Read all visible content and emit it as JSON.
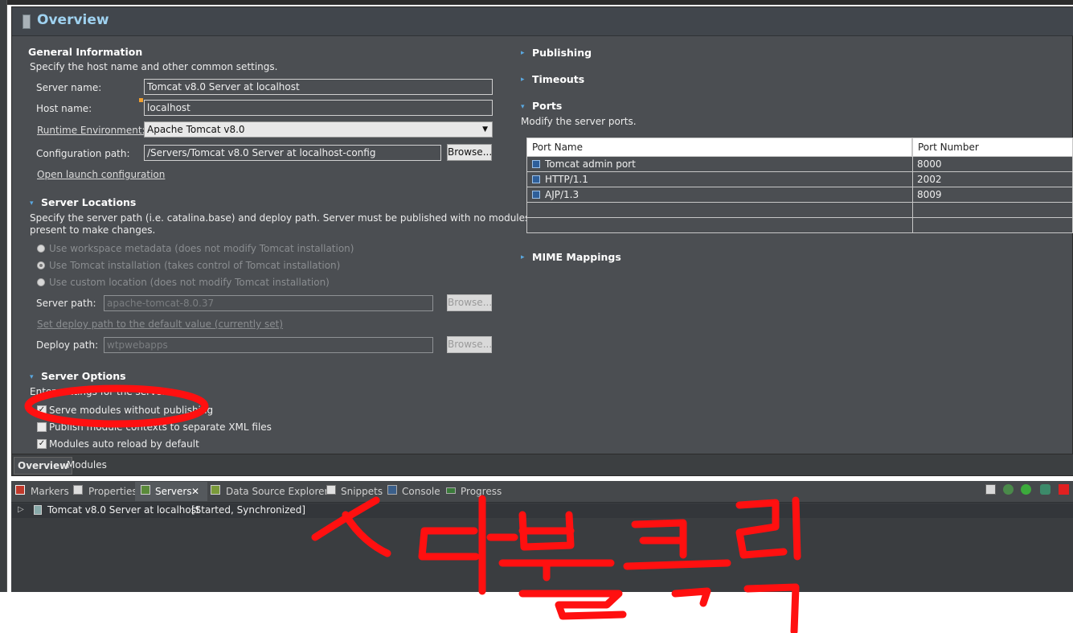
{
  "editor": {
    "title": "Overview",
    "general": {
      "title": "General Information",
      "desc": "Specify the host name and other common settings.",
      "server_name_label": "Server name:",
      "server_name_value": "Tomcat v8.0 Server at localhost",
      "host_name_label": "Host name:",
      "host_name_value": "localhost",
      "runtime_label": "Runtime Environment:",
      "runtime_value": "Apache Tomcat v8.0",
      "config_label": "Configuration path:",
      "config_value": "/Servers/Tomcat v8.0 Server at localhost-config",
      "browse_label": "Browse...",
      "open_launch_link": "Open launch configuration"
    },
    "locations": {
      "title": "Server Locations",
      "desc_line1": "Specify the server path (i.e. catalina.base) and deploy path. Server must be published with no modules",
      "desc_line2": "present to make changes.",
      "radio1": "Use workspace metadata (does not modify Tomcat installation)",
      "radio2": "Use Tomcat installation (takes control of Tomcat installation)",
      "radio3": "Use custom location (does not modify Tomcat installation)",
      "server_path_label": "Server path:",
      "server_path_value": "apache-tomcat-8.0.37",
      "browse_label": "Browse...",
      "set_deploy_link": "Set deploy path to the default value (currently set)",
      "deploy_path_label": "Deploy path:",
      "deploy_path_value": "wtpwebapps"
    },
    "options": {
      "title": "Server Options",
      "desc": "Enter settings for the server.",
      "opt1": "Serve modules without publishing",
      "opt2": "Publish module contexts to separate XML files",
      "opt3": "Modules auto reload by default"
    },
    "right": {
      "publishing": "Publishing",
      "timeouts": "Timeouts",
      "ports_title": "Ports",
      "ports_desc": "Modify the server ports.",
      "col_name": "Port Name",
      "col_number": "Port Number",
      "ports": [
        {
          "name": "Tomcat admin port",
          "number": "8000"
        },
        {
          "name": "HTTP/1.1",
          "number": "2002"
        },
        {
          "name": "AJP/1.3",
          "number": "8009"
        }
      ],
      "mime": "MIME Mappings"
    },
    "tabs": {
      "overview": "Overview",
      "modules": "Modules"
    }
  },
  "views": {
    "markers": "Markers",
    "properties": "Properties",
    "servers": "Servers",
    "close_glyph": "✕",
    "datasource": "Data Source Explorer",
    "snippets": "Snippets",
    "console": "Console",
    "progress": "Progress",
    "server_entry": "Tomcat v8.0 Server at localhost",
    "server_status": "[Started, Synchronized]"
  },
  "colors": {
    "annotation_red": "#ff1010",
    "title_blue": "#9fd2f0",
    "panel_bg": "#4b4e52"
  }
}
